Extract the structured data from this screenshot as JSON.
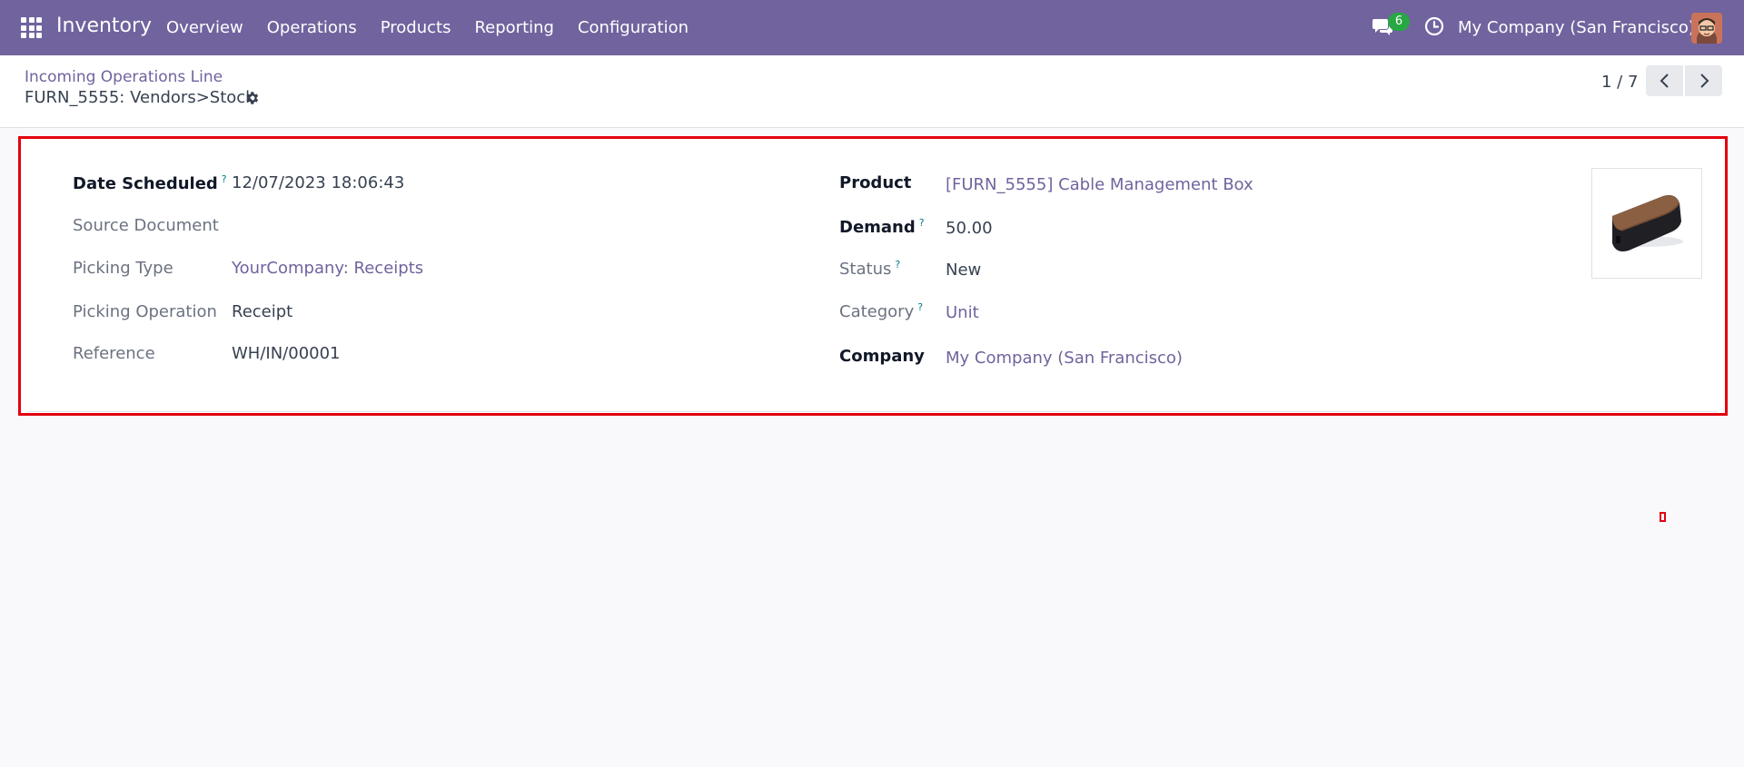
{
  "navbar": {
    "app_name": "Inventory",
    "menu": [
      "Overview",
      "Operations",
      "Products",
      "Reporting",
      "Configuration"
    ],
    "chat_count": "6",
    "company": "My Company (San Francisco)",
    "color": "#71639e"
  },
  "control_panel": {
    "breadcrumb": "Incoming Operations Line",
    "title": "FURN_5555: Vendors>Stock",
    "pager": "1 / 7"
  },
  "form": {
    "left": [
      {
        "label": "Date Scheduled",
        "help": "?",
        "value": "12/07/2023 18:06:43"
      },
      {
        "label": "Source Document",
        "value": ""
      },
      {
        "label": "Picking Type",
        "value": "YourCompany: Receipts"
      },
      {
        "label": "Picking Operation",
        "value": "Receipt"
      },
      {
        "label": "Reference",
        "value": "WH/IN/00001"
      }
    ],
    "right": [
      {
        "label": "Product",
        "value": "[FURN_5555] Cable Management Box"
      },
      {
        "label": "Demand",
        "help": "?",
        "value": "50.00"
      },
      {
        "label": "Status",
        "help": "?",
        "value": "New"
      },
      {
        "label": "Category",
        "help": "?",
        "value": "Unit"
      },
      {
        "label": "Company",
        "value": "My Company (San Francisco)"
      }
    ]
  }
}
